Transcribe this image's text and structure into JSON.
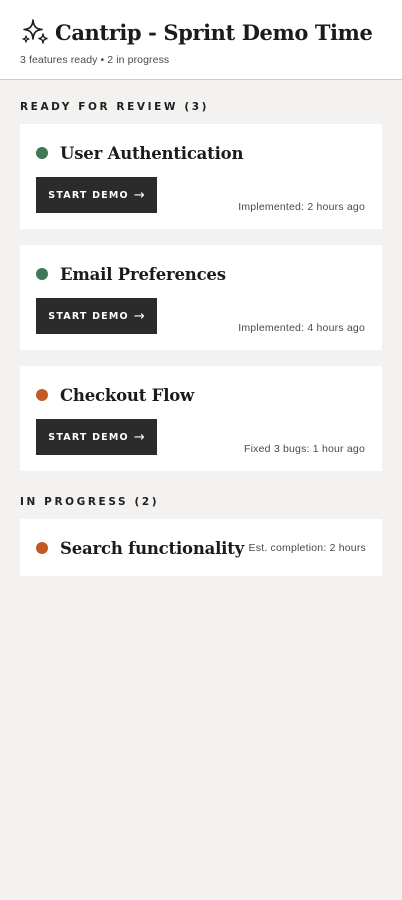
{
  "header": {
    "icon": "sparkles-icon",
    "title": "Cantrip - Sprint Demo Time",
    "subtitle": "3 features ready • 2 in progress"
  },
  "colors": {
    "ready": "#3e7a57",
    "in_progress": "#c35a25",
    "button_bg": "#2b2b2b",
    "background": "#f3f2f0"
  },
  "ready_section": {
    "heading": "READY FOR REVIEW (3)",
    "items": [
      {
        "name": "User Authentication",
        "status": "ready",
        "button_label": "START DEMO",
        "meta": "Implemented: 2 hours ago"
      },
      {
        "name": "Email Preferences",
        "status": "ready",
        "button_label": "START DEMO",
        "meta": "Implemented: 4 hours ago"
      },
      {
        "name": "Checkout Flow",
        "status": "in_progress",
        "button_label": "START DEMO",
        "meta": "Fixed 3 bugs: 1 hour ago"
      }
    ]
  },
  "progress_section": {
    "heading": "IN PROGRESS (2)",
    "items": [
      {
        "name": "Search functionality",
        "status": "in_progress",
        "meta": "Est. completion: 2 hours"
      }
    ]
  },
  "button_arrow": "→"
}
